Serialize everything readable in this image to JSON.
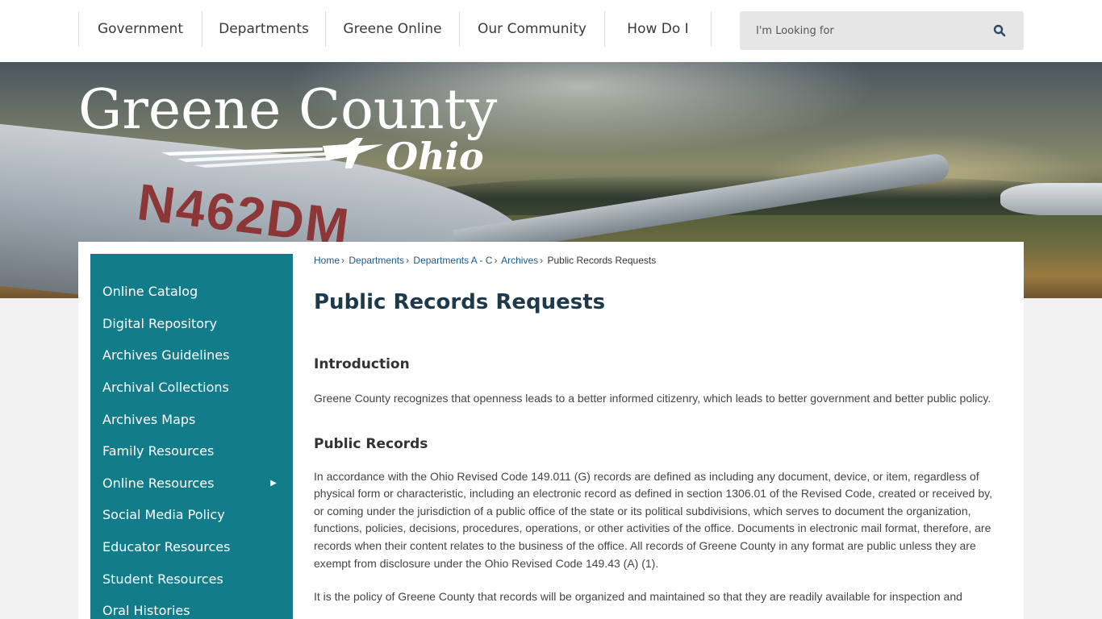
{
  "nav": {
    "items": [
      {
        "label": "Government"
      },
      {
        "label": "Departments"
      },
      {
        "label": "Greene Online"
      },
      {
        "label": "Our Community"
      },
      {
        "label": "How Do I"
      }
    ]
  },
  "search": {
    "placeholder": "I'm Looking for",
    "icon": "search-icon"
  },
  "banner": {
    "logo_title": "Greene County",
    "logo_subtitle": "Ohio",
    "aircraft_registration": "N462DM"
  },
  "sidebar": {
    "items": [
      {
        "label": "Online Catalog"
      },
      {
        "label": "Digital Repository"
      },
      {
        "label": "Archives Guidelines"
      },
      {
        "label": "Archival Collections"
      },
      {
        "label": "Archives Maps"
      },
      {
        "label": "Family Resources"
      },
      {
        "label": "Online Resources",
        "submenu_icon": "triangle-right-icon"
      },
      {
        "label": "Social Media Policy"
      },
      {
        "label": "Educator Resources"
      },
      {
        "label": "Student Resources"
      },
      {
        "label": "Oral Histories"
      }
    ],
    "bg_color": "#137c8a"
  },
  "breadcrumb": {
    "items": [
      "Home",
      "Departments",
      "Departments A - C",
      "Archives"
    ],
    "current": "Public Records Requests"
  },
  "content": {
    "title": "Public Records Requests",
    "intro_heading": "Introduction",
    "intro_text": "Greene County recognizes that openness leads to a better informed citizenry, which leads to better government and better public policy.",
    "records_heading": "Public Records",
    "records_text": "In accordance with the Ohio Revised Code 149.011 (G) records are defined as including any document, device, or item, regardless of physical form or characteristic, including an electronic record as defined in section 1306.01 of the Revised Code, created or received by, or coming under the jurisdiction of a public office of the state or its political subdivisions, which serves to document the organization, functions, policies, decisions, procedures, operations, or other activities of the office. Documents in electronic mail format, therefore, are records when their content relates to the business of the office. All records of Greene County in any format are public unless they are exempt from disclosure under the Ohio Revised Code 149.43 (A) (1).",
    "policy_text": "It is the policy of Greene County that records will be organized and maintained so that they are readily available for inspection and"
  }
}
